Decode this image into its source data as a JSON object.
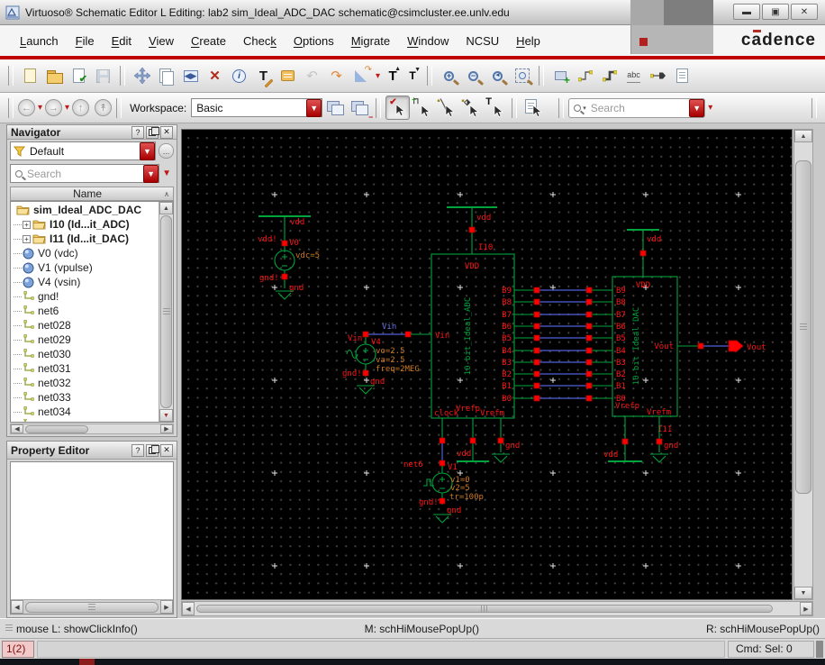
{
  "titlebar": {
    "title": "Virtuoso® Schematic Editor L Editing: lab2 sim_Ideal_ADC_DAC schematic@csimcluster.ee.unlv.edu"
  },
  "menubar": {
    "items": [
      {
        "label": "Launch",
        "u": 0
      },
      {
        "label": "File",
        "u": 0
      },
      {
        "label": "Edit",
        "u": 0
      },
      {
        "label": "View",
        "u": 0
      },
      {
        "label": "Create",
        "u": 0
      },
      {
        "label": "Check",
        "u": 4
      },
      {
        "label": "Options",
        "u": 0
      },
      {
        "label": "Migrate",
        "u": 0
      },
      {
        "label": "Window",
        "u": 0
      },
      {
        "label": "NCSU",
        "u": -1
      },
      {
        "label": "Help",
        "u": 0
      }
    ],
    "logo": {
      "pre": "c",
      "accent": "a",
      "post": "dence"
    }
  },
  "toolbar": {
    "workspace_label": "Workspace:",
    "workspace_value": "Basic",
    "search_placeholder": "Search"
  },
  "navigator": {
    "title": "Navigator",
    "filter_value": "Default",
    "search_placeholder": "Search",
    "column_header": "Name",
    "items": [
      {
        "label": "sim_Ideal_ADC_DAC",
        "icon": "folder",
        "bold": true,
        "expander": false,
        "root": true
      },
      {
        "label": "I10 (Id...it_ADC)",
        "icon": "folder",
        "bold": true,
        "expander": true
      },
      {
        "label": "I11 (Id...it_DAC)",
        "icon": "folder",
        "bold": true,
        "expander": true
      },
      {
        "label": "V0 (vdc)",
        "icon": "instance"
      },
      {
        "label": "V1 (vpulse)",
        "icon": "instance"
      },
      {
        "label": "V4 (vsin)",
        "icon": "instance"
      },
      {
        "label": "gnd!",
        "icon": "net"
      },
      {
        "label": "net6",
        "icon": "net"
      },
      {
        "label": "net028",
        "icon": "net"
      },
      {
        "label": "net029",
        "icon": "net"
      },
      {
        "label": "net030",
        "icon": "net"
      },
      {
        "label": "net031",
        "icon": "net"
      },
      {
        "label": "net032",
        "icon": "net"
      },
      {
        "label": "net033",
        "icon": "net"
      },
      {
        "label": "net034",
        "icon": "net"
      },
      {
        "label": "",
        "icon": "net",
        "partial": true
      }
    ]
  },
  "property_editor": {
    "title": "Property Editor"
  },
  "statusbar": {
    "left": "mouse L: showClickInfo()",
    "middle": "M: schHiMousePopUp()",
    "right": "R: schHiMousePopUp()"
  },
  "cmdbar": {
    "counter": "1(2)",
    "right": "Cmd: Sel: 0"
  },
  "schematic": {
    "labels": {
      "vdd": "vdd",
      "gnd": "gnd"
    },
    "v0": {
      "name": "V0",
      "net_top": "vdd!",
      "net_bot": "gnd!",
      "props": [
        "vdc=5"
      ]
    },
    "v4": {
      "name": "V4",
      "net_label": "Vin",
      "wire_label": "Vin",
      "net_bot": "gnd!",
      "props": [
        "vo=2.5",
        "va=2.5",
        "freq=2MEG"
      ]
    },
    "v1": {
      "name": "V1",
      "net_top": "net6",
      "net_bot": "gnd!",
      "props": [
        "v1=0",
        "v2=5",
        "tr=100p"
      ]
    },
    "adc": {
      "instance": "I10",
      "power_label": "VDD",
      "cell_label": "10-bit_Ideal_ADC",
      "pin_vin": "Vin",
      "pin_clock": "clock",
      "pin_vrefp": "Vrefp",
      "pin_vrefm": "Vrefm",
      "bits": [
        "B9",
        "B8",
        "B7",
        "B6",
        "B5",
        "B4",
        "B3",
        "B2",
        "B1",
        "B0"
      ]
    },
    "dac": {
      "instance": "I11",
      "power_label": "VDD",
      "cell_label": "10-bit Ideal DAC",
      "pin_vout": "Vout",
      "pin_vrefp": "Vrefp",
      "pin_vrefm": "Vrefm",
      "bits": [
        "B9",
        "B8",
        "B7",
        "B6",
        "B5",
        "B4",
        "B3",
        "B2",
        "B1",
        "B0"
      ]
    },
    "out_label": "Vout"
  }
}
